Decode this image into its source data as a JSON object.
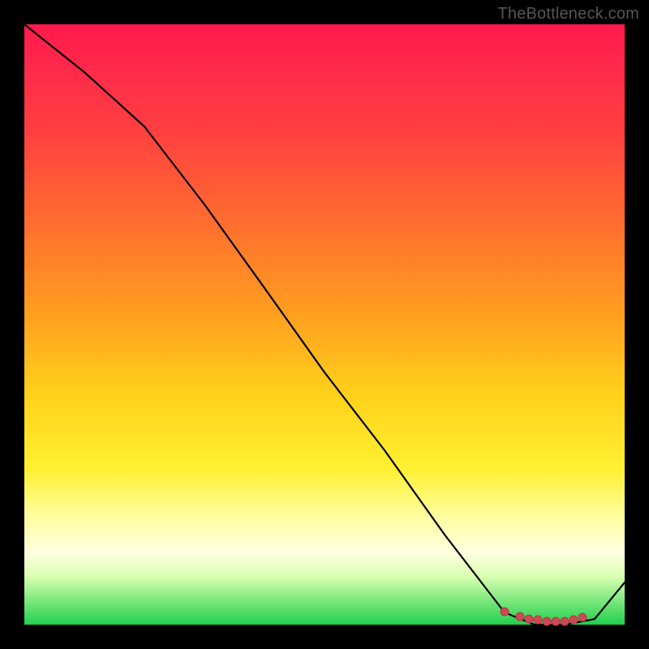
{
  "attribution": "TheBottleneck.com",
  "chart_data": {
    "type": "line",
    "x": [
      0.0,
      0.1,
      0.2,
      0.3,
      0.4,
      0.5,
      0.6,
      0.7,
      0.8,
      0.85,
      0.9,
      0.95,
      1.0
    ],
    "values": [
      1.0,
      0.92,
      0.83,
      0.7,
      0.56,
      0.42,
      0.29,
      0.15,
      0.02,
      0.0,
      0.0,
      0.01,
      0.07
    ],
    "xlim": [
      0,
      1
    ],
    "ylim": [
      0,
      1
    ],
    "xlabel": "",
    "ylabel": "",
    "title": "",
    "highlight_points_x": [
      0.8,
      0.825,
      0.84,
      0.855,
      0.87,
      0.885,
      0.9,
      0.915,
      0.93
    ],
    "highlight_points_y": [
      0.022,
      0.014,
      0.01,
      0.008,
      0.006,
      0.006,
      0.006,
      0.008,
      0.012
    ],
    "background": "vertical-gradient red→yellow→green",
    "line_color": "#000000",
    "dot_color": "#cc4a55"
  }
}
